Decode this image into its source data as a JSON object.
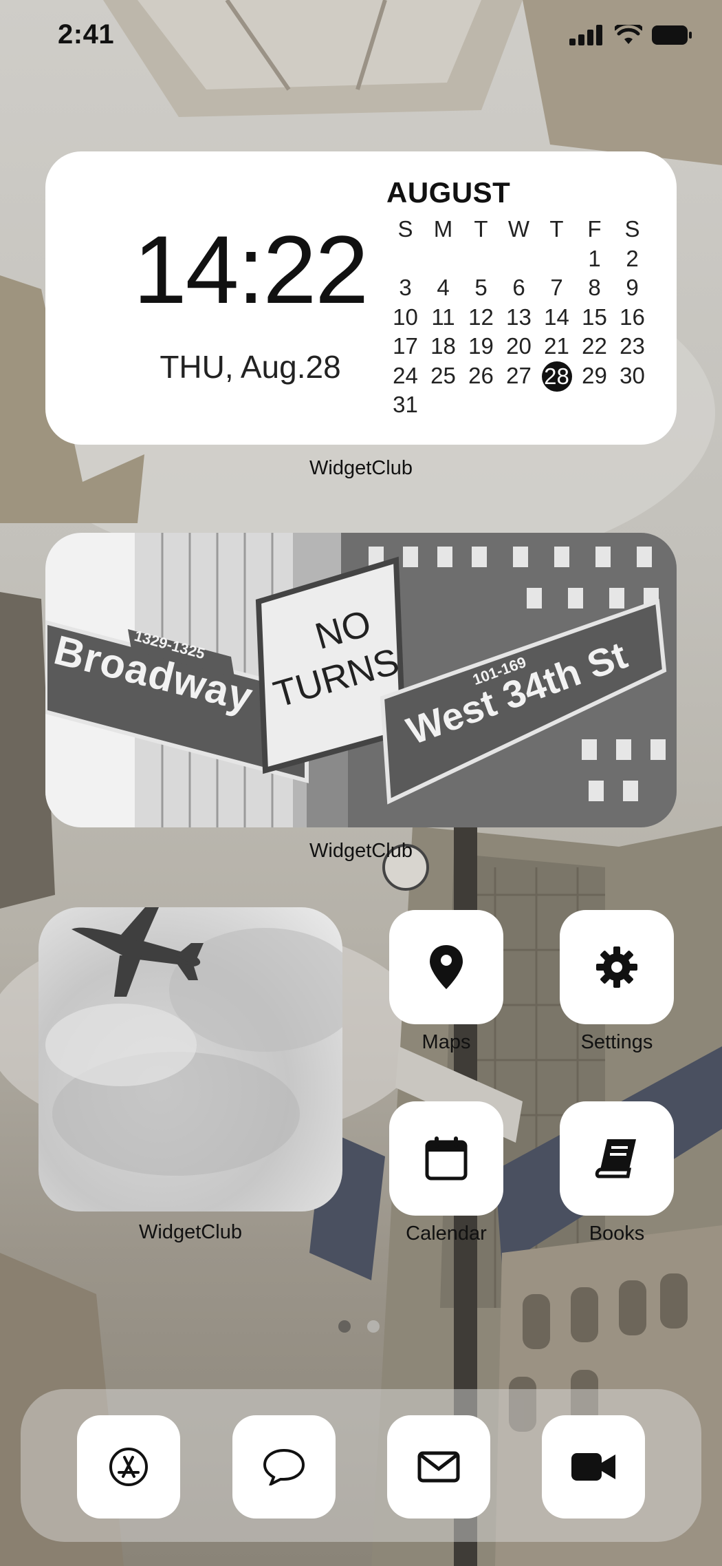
{
  "status_bar": {
    "time": "2:41"
  },
  "clock_widget": {
    "time": "14:22",
    "date": "THU, Aug.28",
    "calendar": {
      "month": "AUGUST",
      "weekdays": [
        "S",
        "M",
        "T",
        "W",
        "T",
        "F",
        "S"
      ],
      "leading_blanks": 5,
      "days": [
        "1",
        "2",
        "3",
        "4",
        "5",
        "6",
        "7",
        "8",
        "9",
        "10",
        "11",
        "12",
        "13",
        "14",
        "15",
        "16",
        "17",
        "18",
        "19",
        "20",
        "21",
        "22",
        "23",
        "24",
        "25",
        "26",
        "27",
        "28",
        "29",
        "30",
        "31"
      ],
      "today": "28"
    },
    "label": "WidgetClub"
  },
  "photo_widget": {
    "label": "WidgetClub",
    "signs": {
      "left_street": "Broadway",
      "left_numbers": "1329-1325",
      "center_line1": "NO",
      "center_line2": "TURNS",
      "right_numbers": "101-169",
      "right_street": "West 34th St"
    }
  },
  "sky_widget": {
    "label": "WidgetClub"
  },
  "apps": [
    {
      "name": "Maps",
      "icon": "map-pin-icon"
    },
    {
      "name": "Settings",
      "icon": "gear-icon"
    },
    {
      "name": "Calendar",
      "icon": "calendar-icon"
    },
    {
      "name": "Books",
      "icon": "book-icon"
    }
  ],
  "dock": [
    {
      "icon": "app-store-icon"
    },
    {
      "icon": "message-bubble-icon"
    },
    {
      "icon": "mail-icon"
    },
    {
      "icon": "video-camera-icon"
    }
  ],
  "page_indicator": {
    "pages": 2,
    "current": 1
  },
  "colors": {
    "widget_bg": "#ffffff",
    "text": "#111111",
    "today_highlight": "#111111"
  }
}
